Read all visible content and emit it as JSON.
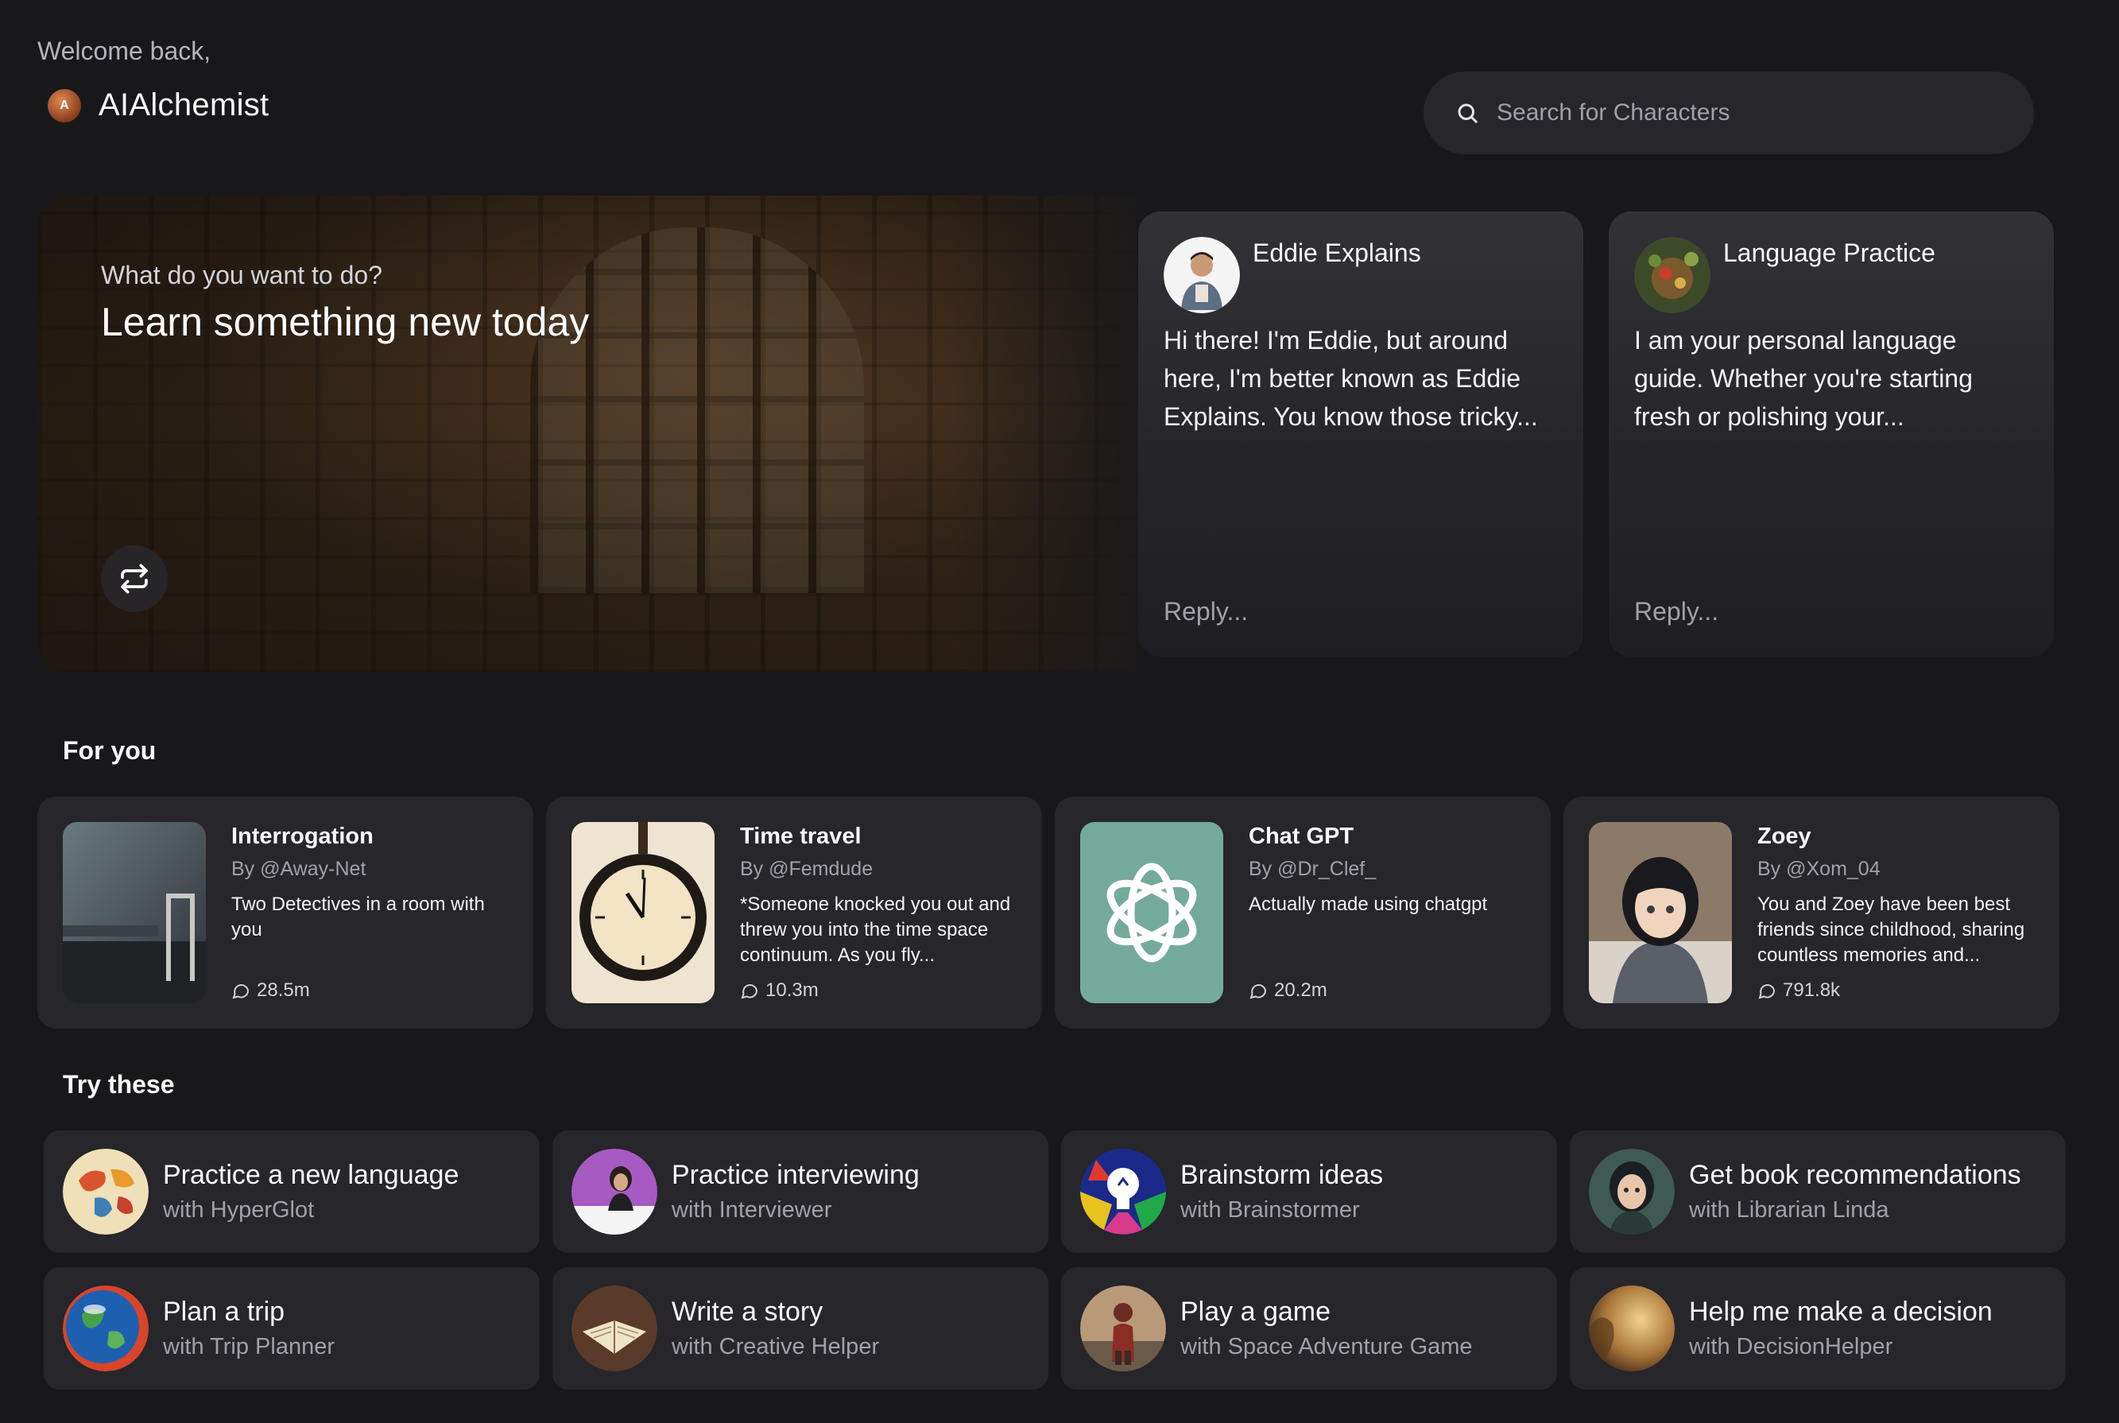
{
  "header": {
    "welcome": "Welcome back,",
    "avatar_letter": "A",
    "username": "AIAlchemist"
  },
  "search": {
    "placeholder": "Search for Characters",
    "icon": "search-icon"
  },
  "hero": {
    "subtitle": "What do you want to do?",
    "title": "Learn something new today",
    "shuffle_icon": "shuffle-icon"
  },
  "featured": [
    {
      "name": "Eddie Explains",
      "message": "Hi there! I'm Eddie, but around here, I'm better known as Eddie Explains. You know those tricky...",
      "reply_placeholder": "Reply..."
    },
    {
      "name": "Language Practice",
      "message": "I am your personal language guide. Whether you're starting fresh or polishing your...",
      "reply_placeholder": "Reply..."
    }
  ],
  "for_you": {
    "title": "For you",
    "cards": [
      {
        "title": "Interrogation",
        "by": "By @Away-Net",
        "desc": "Two Detectives in a room with you",
        "count": "28.5m"
      },
      {
        "title": "Time travel",
        "by": "By @Femdude",
        "desc": "*Someone knocked you out and threw you into the time space continuum. As you fly...",
        "count": "10.3m"
      },
      {
        "title": "Chat GPT",
        "by": "By @Dr_Clef_",
        "desc": "Actually made using chatgpt",
        "count": "20.2m"
      },
      {
        "title": "Zoey",
        "by": "By @Xom_04",
        "desc": "You and Zoey have been best friends since childhood, sharing countless memories and...",
        "count": "791.8k"
      }
    ]
  },
  "try_these": {
    "title": "Try these",
    "items": [
      {
        "title": "Practice a new language",
        "sub": "with HyperGlot"
      },
      {
        "title": "Practice interviewing",
        "sub": "with Interviewer"
      },
      {
        "title": "Brainstorm ideas",
        "sub": "with Brainstormer"
      },
      {
        "title": "Get book recommendations",
        "sub": "with Librarian Linda"
      },
      {
        "title": "Plan a trip",
        "sub": "with Trip Planner"
      },
      {
        "title": "Write a story",
        "sub": "with Creative Helper"
      },
      {
        "title": "Play a game",
        "sub": "with Space Adventure Game"
      },
      {
        "title": "Help me make a decision",
        "sub": "with DecisionHelper"
      }
    ]
  },
  "colors": {
    "background": "#18181b",
    "card": "#26262b",
    "muted_text": "#a1a1aa",
    "chatgpt_teal": "#74aa9c"
  }
}
